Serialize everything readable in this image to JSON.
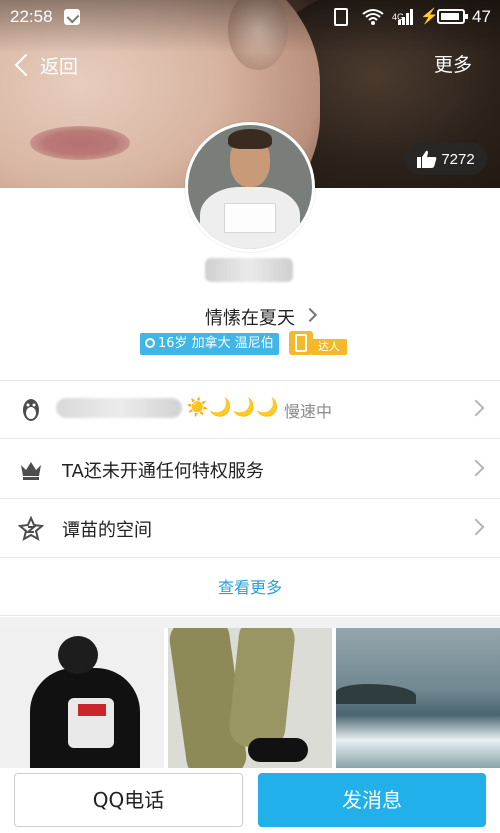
{
  "status_bar": {
    "time": "22:58",
    "net": "4G",
    "battery": "47"
  },
  "nav": {
    "back_label": "返回",
    "more_label": "更多"
  },
  "likes": {
    "count": "7272"
  },
  "profile": {
    "signature": "情愫在夏天",
    "info_tag": "16岁 加拿大 温尼伯",
    "badge_label": "达人"
  },
  "rows": {
    "qq_level": {
      "level_icons": "☀️🌙🌙🌙",
      "status": "慢速中"
    },
    "vip": {
      "label": "TA还未开通任何特权服务"
    },
    "space": {
      "label": "谭苗的空间"
    }
  },
  "see_more": "查看更多",
  "bottom": {
    "call_label": "QQ电话",
    "message_label": "发消息"
  },
  "colors": {
    "accent": "#21b0ea",
    "link": "#2a9fd6",
    "level": "#f0b429",
    "daren": "#f4b82a"
  }
}
